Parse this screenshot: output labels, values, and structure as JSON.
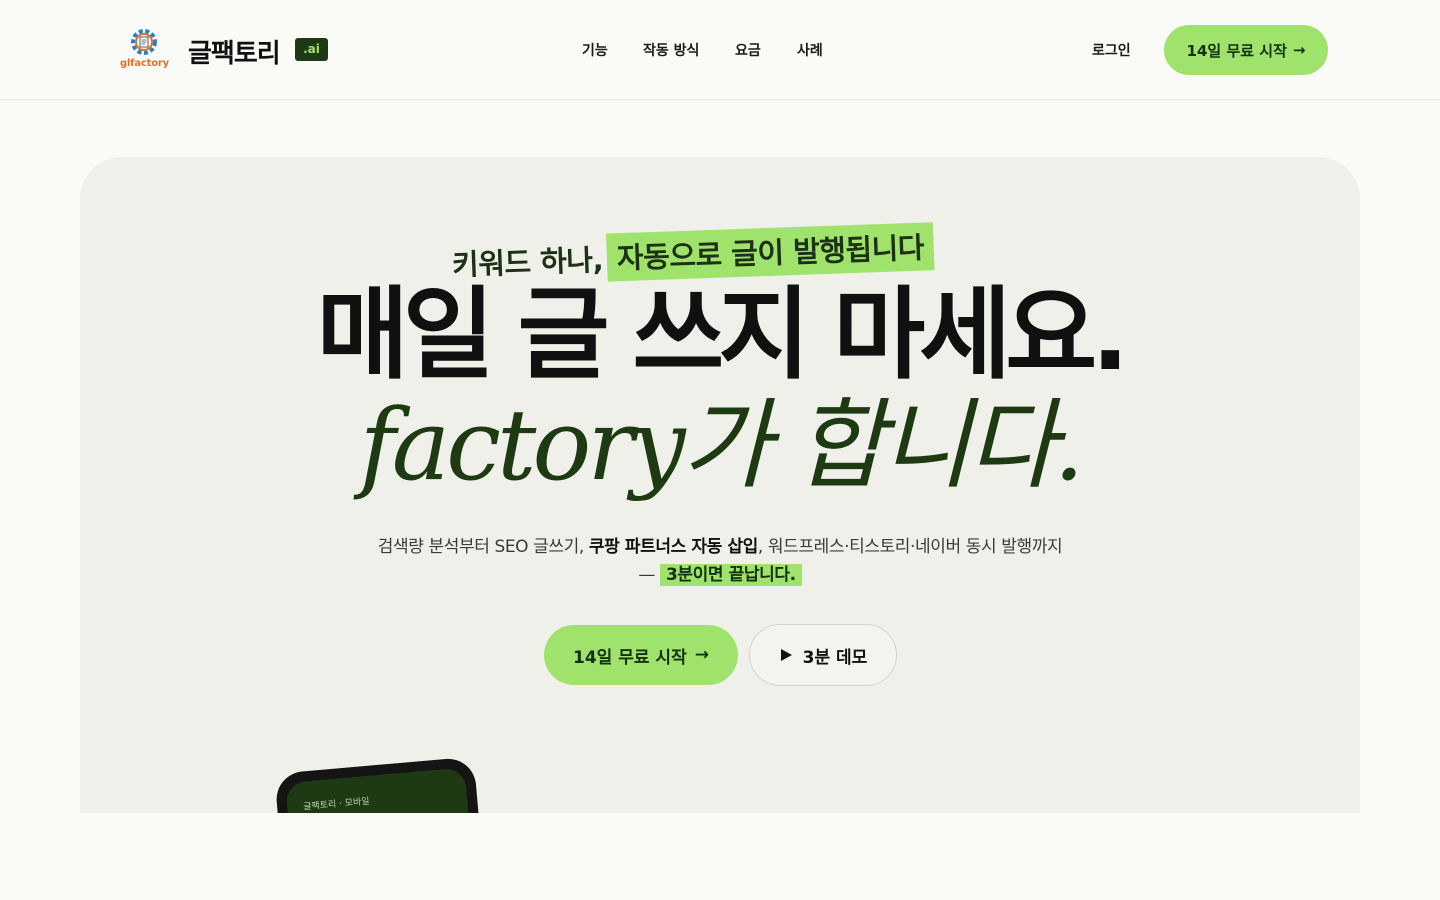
{
  "header": {
    "logo_text": "glfactory",
    "brand": "글팩토리",
    "badge": ".ai",
    "nav": [
      "기능",
      "작동 방식",
      "요금",
      "사례"
    ],
    "login": "로그인",
    "cta": "14일 무료 시작",
    "cta_arrow": "→"
  },
  "hero": {
    "eyebrow_plain": "키워드 하나,",
    "eyebrow_highlight": "자동으로 글이 발행됩니다",
    "headline": "매일 글 쓰지 마세요.",
    "subhead": "factory가 합니다.",
    "desc_line1_a": "검색량 분석부터 SEO 글쓰기, ",
    "desc_line1_bold": "쿠팡 파트너스 자동 삽입",
    "desc_line1_b": ", 워드프레스·티스토리·네이버 동시 발행까지",
    "desc_line2_dash": "— ",
    "desc_line2_highlight": "3분이면 끝납니다.",
    "primary_cta": "14일 무료 시작",
    "primary_arrow": "→",
    "demo_cta": "3분 데모",
    "phone_label": "글팩토리 · 모바일"
  },
  "colors": {
    "accent": "#9fe36d",
    "dark_green": "#1e3a12",
    "background": "#fafaf6"
  }
}
